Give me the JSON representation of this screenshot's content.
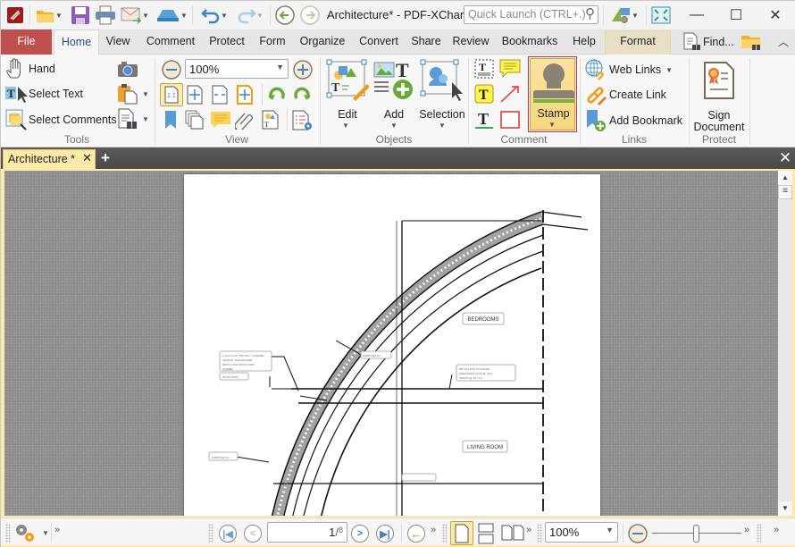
{
  "titlebar": {
    "title": "Architecture* - PDF-XChan..",
    "quick_launch_placeholder": "Quick Launch (CTRL+.)",
    "icons": [
      "app-logo-icon",
      "open-folder-icon",
      "save-icon",
      "print-icon",
      "email-icon",
      "scan-icon",
      "undo-icon",
      "redo-icon",
      "back-icon",
      "forward-icon",
      "ui-options-icon",
      "fullscreen-icon"
    ]
  },
  "window_controls": {
    "minimize": "—",
    "maximize": "☐",
    "close": "✕"
  },
  "tabs": [
    {
      "label": "File"
    },
    {
      "label": "Home"
    },
    {
      "label": "View"
    },
    {
      "label": "Comment"
    },
    {
      "label": "Protect"
    },
    {
      "label": "Form"
    },
    {
      "label": "Organize"
    },
    {
      "label": "Convert"
    },
    {
      "label": "Share"
    },
    {
      "label": "Review"
    },
    {
      "label": "Bookmarks"
    },
    {
      "label": "Help"
    },
    {
      "label": "Format"
    }
  ],
  "tabs_right": {
    "find_label": "Find..."
  },
  "ribbon": {
    "tools": {
      "label": "Tools",
      "hand": "Hand",
      "select_text": "Select Text",
      "select_comments": "Select Comments"
    },
    "view": {
      "label": "View",
      "zoom_value": "100%"
    },
    "objects": {
      "label": "Objects",
      "edit": "Edit",
      "add": "Add",
      "selection": "Selection"
    },
    "comment": {
      "label": "Comment",
      "stamp": "Stamp"
    },
    "links": {
      "label": "Links",
      "web_links": "Web Links",
      "create_link": "Create Link",
      "add_bookmark": "Add Bookmark"
    },
    "protect": {
      "label": "Protect",
      "sign_line1": "Sign",
      "sign_line2": "Document"
    }
  },
  "document_tab": {
    "label": "Architecture *"
  },
  "drawing": {
    "room_labels": [
      "BEDROOMS",
      "LIVING ROOM"
    ],
    "callouts": [
      "FORM SET A1",
      "POUR JOINT",
      "FORM SET A1"
    ]
  },
  "statusbar": {
    "page_current": "1",
    "page_total": "8",
    "zoom_value": "100%",
    "zoom_slider_value": 0.5
  },
  "colors": {
    "file_tab": "#c0504d",
    "active_tab_text": "#1f4e8c",
    "doc_tab": "#fde9a8",
    "stamp_highlight": "#d13438"
  }
}
